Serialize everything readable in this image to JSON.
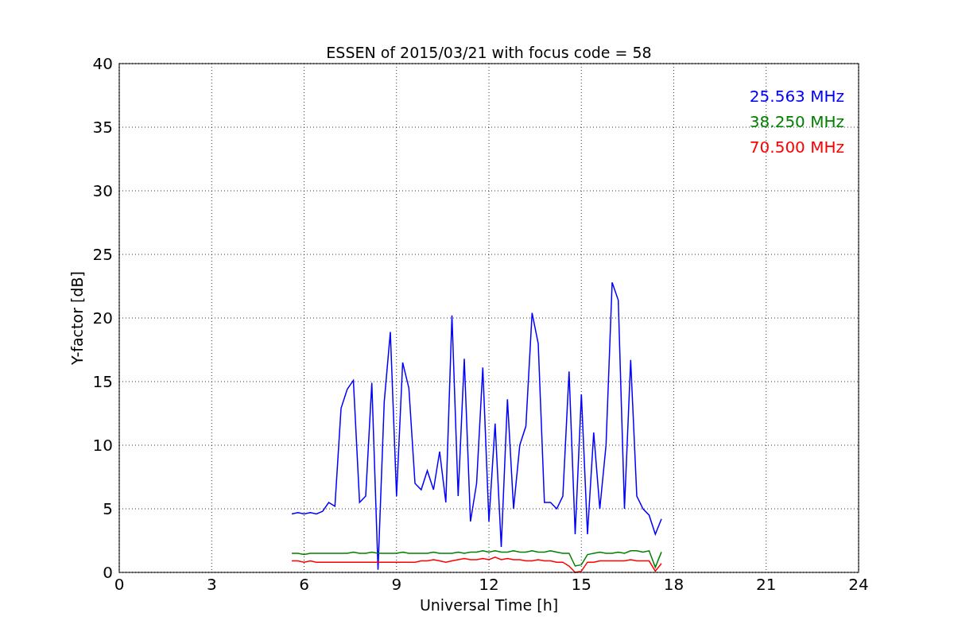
{
  "chart_data": {
    "type": "line",
    "title": "ESSEN of 2015/03/21 with focus code = 58",
    "xlabel": "Universal Time [h]",
    "ylabel": "Y-factor [dB]",
    "x": [
      5.6,
      5.8,
      6.0,
      6.2,
      6.4,
      6.6,
      6.8,
      7.0,
      7.2,
      7.4,
      7.6,
      7.8,
      8.0,
      8.2,
      8.4,
      8.6,
      8.8,
      9.0,
      9.2,
      9.4,
      9.6,
      9.8,
      10.0,
      10.2,
      10.4,
      10.6,
      10.8,
      11.0,
      11.2,
      11.4,
      11.6,
      11.8,
      12.0,
      12.2,
      12.4,
      12.6,
      12.8,
      13.0,
      13.2,
      13.4,
      13.6,
      13.8,
      14.0,
      14.2,
      14.4,
      14.6,
      14.8,
      15.0,
      15.2,
      15.4,
      15.6,
      15.8,
      16.0,
      16.2,
      16.4,
      16.6,
      16.8,
      17.0,
      17.2,
      17.4,
      17.6
    ],
    "series": [
      {
        "name": "25.563 MHz",
        "color": "#0000ff",
        "values": [
          4.6,
          4.7,
          4.6,
          4.7,
          4.6,
          4.8,
          5.5,
          5.2,
          12.9,
          14.4,
          15.1,
          5.5,
          6.0,
          14.9,
          0.2,
          13.4,
          18.9,
          6.0,
          16.5,
          14.5,
          7.0,
          6.5,
          8.0,
          6.5,
          9.5,
          5.5,
          20.2,
          6.0,
          16.8,
          4.0,
          7.0,
          16.1,
          4.0,
          11.7,
          2.0,
          13.6,
          5.0,
          10.0,
          11.5,
          20.4,
          18.0,
          5.5,
          5.5,
          5.0,
          6.0,
          15.8,
          3.0,
          14.0,
          3.0,
          11.0,
          5.0,
          10.0,
          22.8,
          21.4,
          5.0,
          16.7,
          6.0,
          5.0,
          4.5,
          3.0,
          4.2
        ]
      },
      {
        "name": "38.250 MHz",
        "color": "#008000",
        "values": [
          1.5,
          1.5,
          1.4,
          1.5,
          1.5,
          1.5,
          1.5,
          1.5,
          1.5,
          1.5,
          1.6,
          1.5,
          1.5,
          1.6,
          1.5,
          1.5,
          1.5,
          1.5,
          1.6,
          1.5,
          1.5,
          1.5,
          1.5,
          1.6,
          1.5,
          1.5,
          1.5,
          1.6,
          1.5,
          1.6,
          1.6,
          1.7,
          1.6,
          1.7,
          1.6,
          1.6,
          1.7,
          1.6,
          1.6,
          1.7,
          1.6,
          1.6,
          1.7,
          1.6,
          1.5,
          1.5,
          0.5,
          0.6,
          1.4,
          1.5,
          1.6,
          1.5,
          1.5,
          1.6,
          1.5,
          1.7,
          1.7,
          1.6,
          1.7,
          0.4,
          1.6
        ]
      },
      {
        "name": "70.500 MHz",
        "color": "#ff0000",
        "values": [
          0.9,
          0.9,
          0.8,
          0.9,
          0.8,
          0.8,
          0.8,
          0.8,
          0.8,
          0.8,
          0.8,
          0.8,
          0.8,
          0.8,
          0.8,
          0.8,
          0.8,
          0.8,
          0.8,
          0.8,
          0.8,
          0.9,
          0.9,
          1.0,
          0.9,
          0.8,
          0.9,
          1.0,
          1.1,
          1.0,
          1.0,
          1.1,
          1.0,
          1.2,
          1.0,
          1.1,
          1.0,
          1.0,
          0.9,
          0.9,
          1.0,
          0.9,
          0.9,
          0.8,
          0.8,
          0.5,
          0.0,
          0.1,
          0.8,
          0.8,
          0.9,
          0.9,
          0.9,
          0.9,
          0.9,
          1.0,
          0.9,
          0.9,
          0.9,
          0.1,
          0.7
        ]
      }
    ],
    "grid": true,
    "xlim": [
      0,
      24
    ],
    "ylim": [
      0,
      40
    ],
    "xticks": [
      0,
      3,
      6,
      9,
      12,
      15,
      18,
      21,
      24
    ],
    "yticks": [
      0,
      5,
      10,
      15,
      20,
      25,
      30,
      35,
      40
    ]
  }
}
